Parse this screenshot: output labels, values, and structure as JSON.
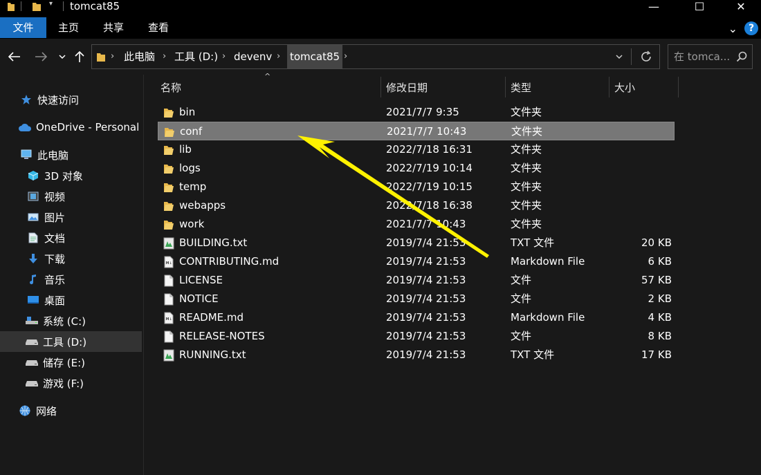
{
  "window": {
    "title": "tomcat85",
    "controls": {
      "minimize": "—",
      "maximize": "☐",
      "close": "✕"
    }
  },
  "ribbon": {
    "tabs": [
      {
        "label": "文件",
        "active": true
      },
      {
        "label": "主页",
        "active": false
      },
      {
        "label": "共享",
        "active": false
      },
      {
        "label": "查看",
        "active": false
      }
    ],
    "help": "?"
  },
  "address": {
    "crumbs": [
      "此电脑",
      "工具 (D:)",
      "devenv",
      "tomcat85"
    ]
  },
  "search": {
    "placeholder": "在 tomca..."
  },
  "sidebar": {
    "items": [
      {
        "label": "快速访问",
        "icon": "star-icon"
      },
      {
        "label": "OneDrive - Personal",
        "icon": "cloud-icon"
      },
      {
        "label": "此电脑",
        "icon": "computer-icon"
      },
      {
        "label": "3D 对象",
        "icon": "cube-icon"
      },
      {
        "label": "视频",
        "icon": "video-icon"
      },
      {
        "label": "图片",
        "icon": "picture-icon"
      },
      {
        "label": "文档",
        "icon": "document-icon"
      },
      {
        "label": "下载",
        "icon": "download-icon"
      },
      {
        "label": "音乐",
        "icon": "music-icon"
      },
      {
        "label": "桌面",
        "icon": "desktop-icon"
      },
      {
        "label": "系统 (C:)",
        "icon": "system-drive-icon"
      },
      {
        "label": "工具 (D:)",
        "icon": "drive-icon"
      },
      {
        "label": "储存 (E:)",
        "icon": "drive-icon"
      },
      {
        "label": "游戏 (F:)",
        "icon": "drive-icon"
      },
      {
        "label": "网络",
        "icon": "network-icon"
      }
    ]
  },
  "columns": {
    "name": "名称",
    "modified": "修改日期",
    "type": "类型",
    "size": "大小"
  },
  "files": [
    {
      "name": "bin",
      "modified": "2021/7/7 9:35",
      "type": "文件夹",
      "size": "",
      "icon": "folder-icon"
    },
    {
      "name": "conf",
      "modified": "2021/7/7 10:43",
      "type": "文件夹",
      "size": "",
      "icon": "folder-icon",
      "selected": true
    },
    {
      "name": "lib",
      "modified": "2022/7/18 16:31",
      "type": "文件夹",
      "size": "",
      "icon": "folder-icon"
    },
    {
      "name": "logs",
      "modified": "2022/7/19 10:14",
      "type": "文件夹",
      "size": "",
      "icon": "folder-icon"
    },
    {
      "name": "temp",
      "modified": "2022/7/19 10:15",
      "type": "文件夹",
      "size": "",
      "icon": "folder-icon"
    },
    {
      "name": "webapps",
      "modified": "2022/7/18 16:38",
      "type": "文件夹",
      "size": "",
      "icon": "folder-icon"
    },
    {
      "name": "work",
      "modified": "2021/7/7 10:43",
      "type": "文件夹",
      "size": "",
      "icon": "folder-icon"
    },
    {
      "name": "BUILDING.txt",
      "modified": "2019/7/4 21:53",
      "type": "TXT 文件",
      "size": "20 KB",
      "icon": "text-file-icon"
    },
    {
      "name": "CONTRIBUTING.md",
      "modified": "2019/7/4 21:53",
      "type": "Markdown File",
      "size": "6 KB",
      "icon": "markdown-file-icon"
    },
    {
      "name": "LICENSE",
      "modified": "2019/7/4 21:53",
      "type": "文件",
      "size": "57 KB",
      "icon": "file-icon"
    },
    {
      "name": "NOTICE",
      "modified": "2019/7/4 21:53",
      "type": "文件",
      "size": "2 KB",
      "icon": "file-icon"
    },
    {
      "name": "README.md",
      "modified": "2019/7/4 21:53",
      "type": "Markdown File",
      "size": "4 KB",
      "icon": "markdown-file-icon"
    },
    {
      "name": "RELEASE-NOTES",
      "modified": "2019/7/4 21:53",
      "type": "文件",
      "size": "8 KB",
      "icon": "file-icon"
    },
    {
      "name": "RUNNING.txt",
      "modified": "2019/7/4 21:53",
      "type": "TXT 文件",
      "size": "17 KB",
      "icon": "text-file-icon"
    }
  ],
  "colors": {
    "accent": "#1a6fc2",
    "folder": "#e8b84b",
    "annotation_arrow": "#fff200"
  }
}
